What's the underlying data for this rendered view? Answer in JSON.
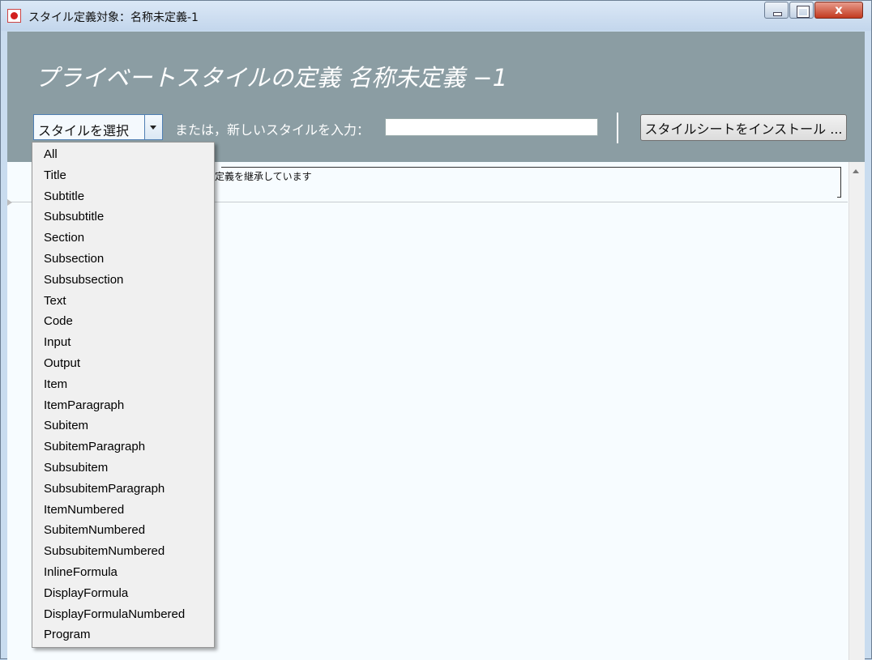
{
  "window": {
    "title": "スタイル定義対象：名称未定義-1",
    "close_label": "x",
    "app_icon": "app-icon"
  },
  "header": {
    "title": "プライベートスタイルの定義 名称未定義 −1",
    "style_combo_label": "スタイルを選択",
    "or_label": "または，新しいスタイルを入力：",
    "new_style_value": "",
    "install_button_label": "スタイルシートをインストール ..."
  },
  "content": {
    "cell_text": "定義を継承しています"
  },
  "dropdown": {
    "items": [
      "All",
      "Title",
      "Subtitle",
      "Subsubtitle",
      "Section",
      "Subsection",
      "Subsubsection",
      "Text",
      "Code",
      "Input",
      "Output",
      "Item",
      "ItemParagraph",
      "Subitem",
      "SubitemParagraph",
      "Subsubitem",
      "SubsubitemParagraph",
      "ItemNumbered",
      "SubitemNumbered",
      "SubsubitemNumbered",
      "InlineFormula",
      "DisplayFormula",
      "DisplayFormulaNumbered",
      "Program"
    ]
  }
}
